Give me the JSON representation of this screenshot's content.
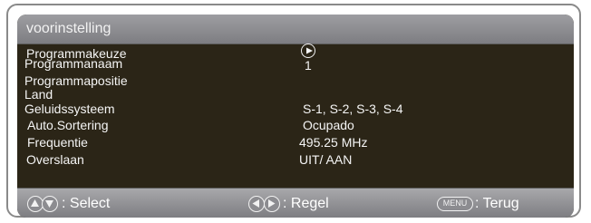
{
  "window": {
    "title": "voorinstelling"
  },
  "menu": {
    "rows": [
      {
        "label": "Programmakeuze",
        "value": ""
      },
      {
        "label": "Programmanaam",
        "value": "1"
      },
      {
        "label": "Programmapositie",
        "value": ""
      },
      {
        "label": "Land",
        "value": ""
      },
      {
        "label": "Geluidssysteem",
        "value": "S-1, S-2, S-3, S-4"
      },
      {
        "label": "Auto.Sortering",
        "value": "Ocupado"
      },
      {
        "label": "Frequentie",
        "value": "495.25 MHz"
      },
      {
        "label": "Overslaan",
        "value": "UIT/ AAN"
      }
    ]
  },
  "footer": {
    "select_hint": ": Select",
    "adjust_hint": ": Regel",
    "menu_key_label": "MENU",
    "back_hint": ": Terug"
  },
  "icons": {
    "play": "play-circle-icon",
    "updown": "up-down-buttons-icon",
    "leftright": "left-right-buttons-icon"
  }
}
